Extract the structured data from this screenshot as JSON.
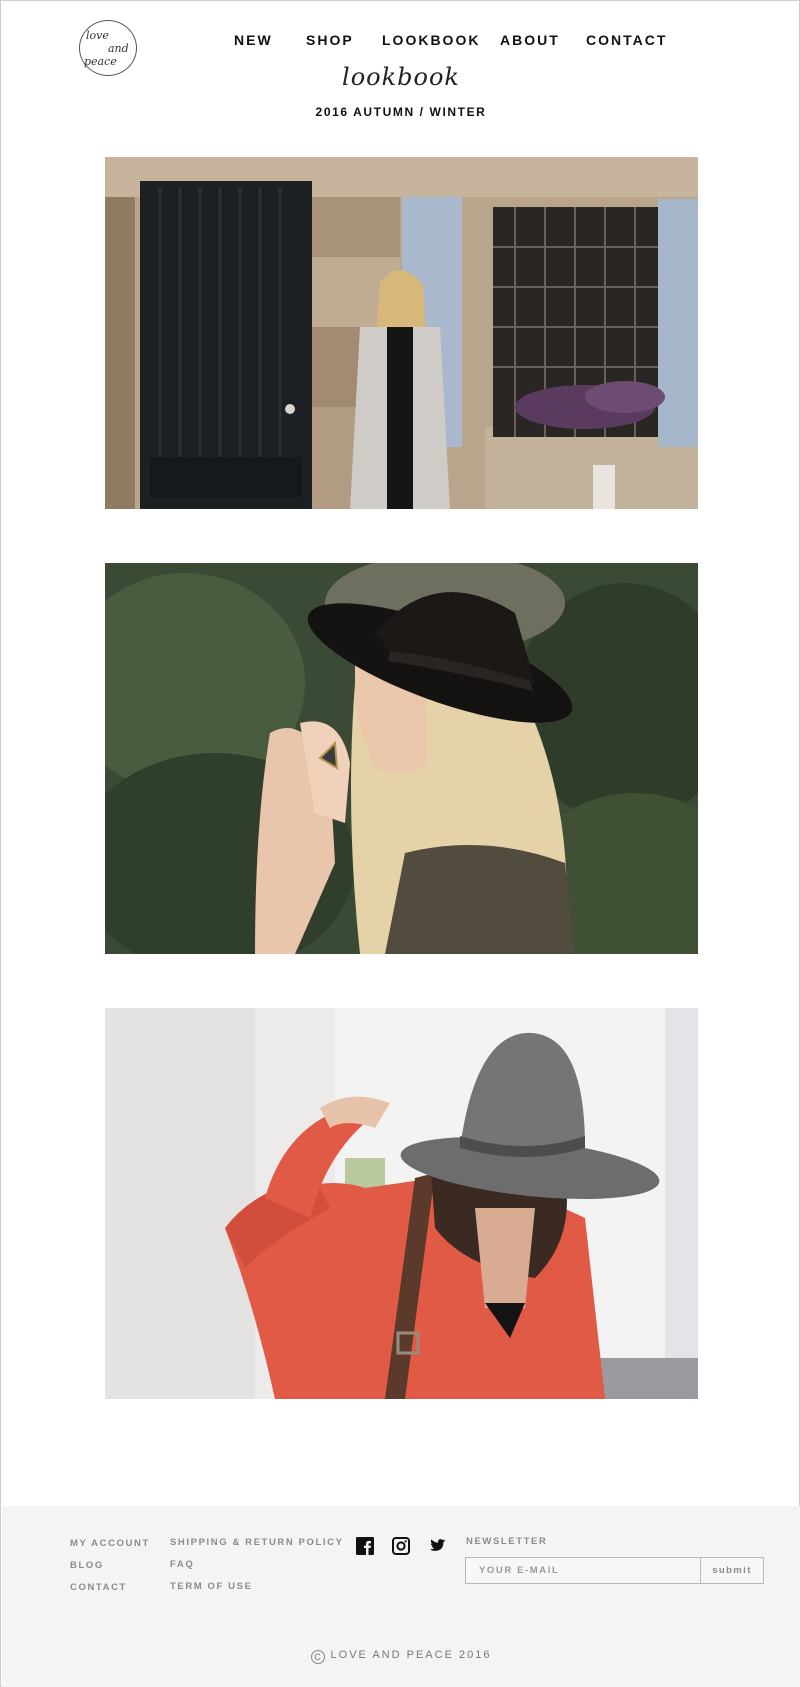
{
  "header": {
    "logo_lines": [
      "love",
      "and",
      "peace"
    ],
    "nav": [
      "NEW",
      "SHOP",
      "LOOKBOOK",
      "ABOUT",
      "CONTACT"
    ],
    "script_title": "lookbook",
    "season": "2016 AUTUMN / WINTER"
  },
  "gallery": {
    "photos": [
      {
        "description_icon": "photo-woman-by-doorway"
      },
      {
        "description_icon": "photo-woman-black-hat"
      },
      {
        "description_icon": "photo-woman-grey-hat"
      }
    ]
  },
  "footer": {
    "links_col1": [
      "MY ACCOUNT",
      "BLOG",
      "CONTACT"
    ],
    "links_col2": [
      "SHIPPING & RETURN POLICY",
      "FAQ",
      "TERM OF USE"
    ],
    "social_icons": [
      "facebook-icon",
      "instagram-icon",
      "twitter-icon"
    ],
    "newsletter": {
      "label": "NEWSLETTER",
      "placeholder": "YOUR E-MAIL",
      "submit": "submit"
    },
    "copyright_symbol": "C",
    "copyright": "LOVE AND PEACE 2016"
  },
  "colors": {
    "footer_bg": "#f4f4f4",
    "nav_text": "#111111",
    "muted_text": "#8b8b8b"
  }
}
